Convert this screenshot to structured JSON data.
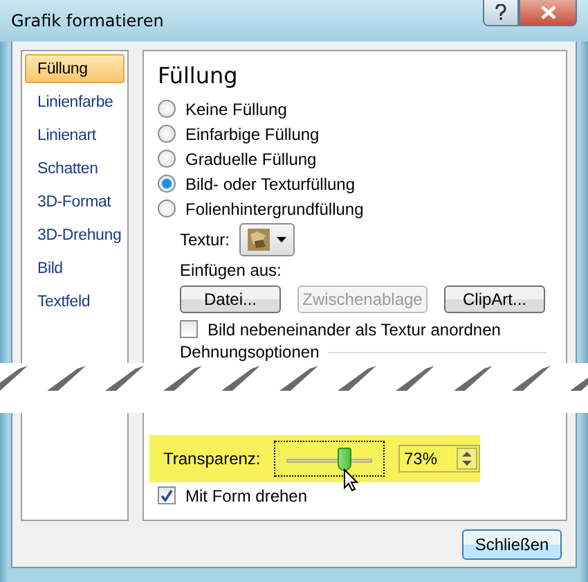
{
  "window": {
    "title": "Grafik formatieren"
  },
  "nav": [
    {
      "label": "Füllung",
      "selected": true
    },
    {
      "label": "Linienfarbe",
      "selected": false
    },
    {
      "label": "Linienart",
      "selected": false
    },
    {
      "label": "Schatten",
      "selected": false
    },
    {
      "label": "3D-Format",
      "selected": false
    },
    {
      "label": "3D-Drehung",
      "selected": false
    },
    {
      "label": "Bild",
      "selected": false
    },
    {
      "label": "Textfeld",
      "selected": false
    }
  ],
  "panel": {
    "heading": "Füllung",
    "fill_options": [
      {
        "label": "Keine Füllung",
        "selected": false
      },
      {
        "label": "Einfarbige Füllung",
        "selected": false
      },
      {
        "label": "Graduelle Füllung",
        "selected": false
      },
      {
        "label": "Bild- oder Texturfüllung",
        "selected": true
      },
      {
        "label": "Folienhintergrundfüllung",
        "selected": false
      }
    ],
    "texture": {
      "label": "Textur:"
    },
    "insert_from": {
      "label": "Einfügen aus:",
      "buttons": [
        {
          "label": "Datei...",
          "disabled": false
        },
        {
          "label": "Zwischenablage",
          "disabled": true
        },
        {
          "label": "ClipArt...",
          "disabled": false
        }
      ]
    },
    "tile": {
      "label": "Bild nebeneinander als Textur anordnen",
      "checked": false
    },
    "stretch_section": {
      "label": "Dehnungsoptionen"
    },
    "transparency": {
      "label": "Transparenz:",
      "level": 0.68,
      "value": "73%"
    },
    "rotate_with_shape": {
      "label": "Mit Form drehen",
      "checked": true
    }
  },
  "close_button": "Schließen"
}
